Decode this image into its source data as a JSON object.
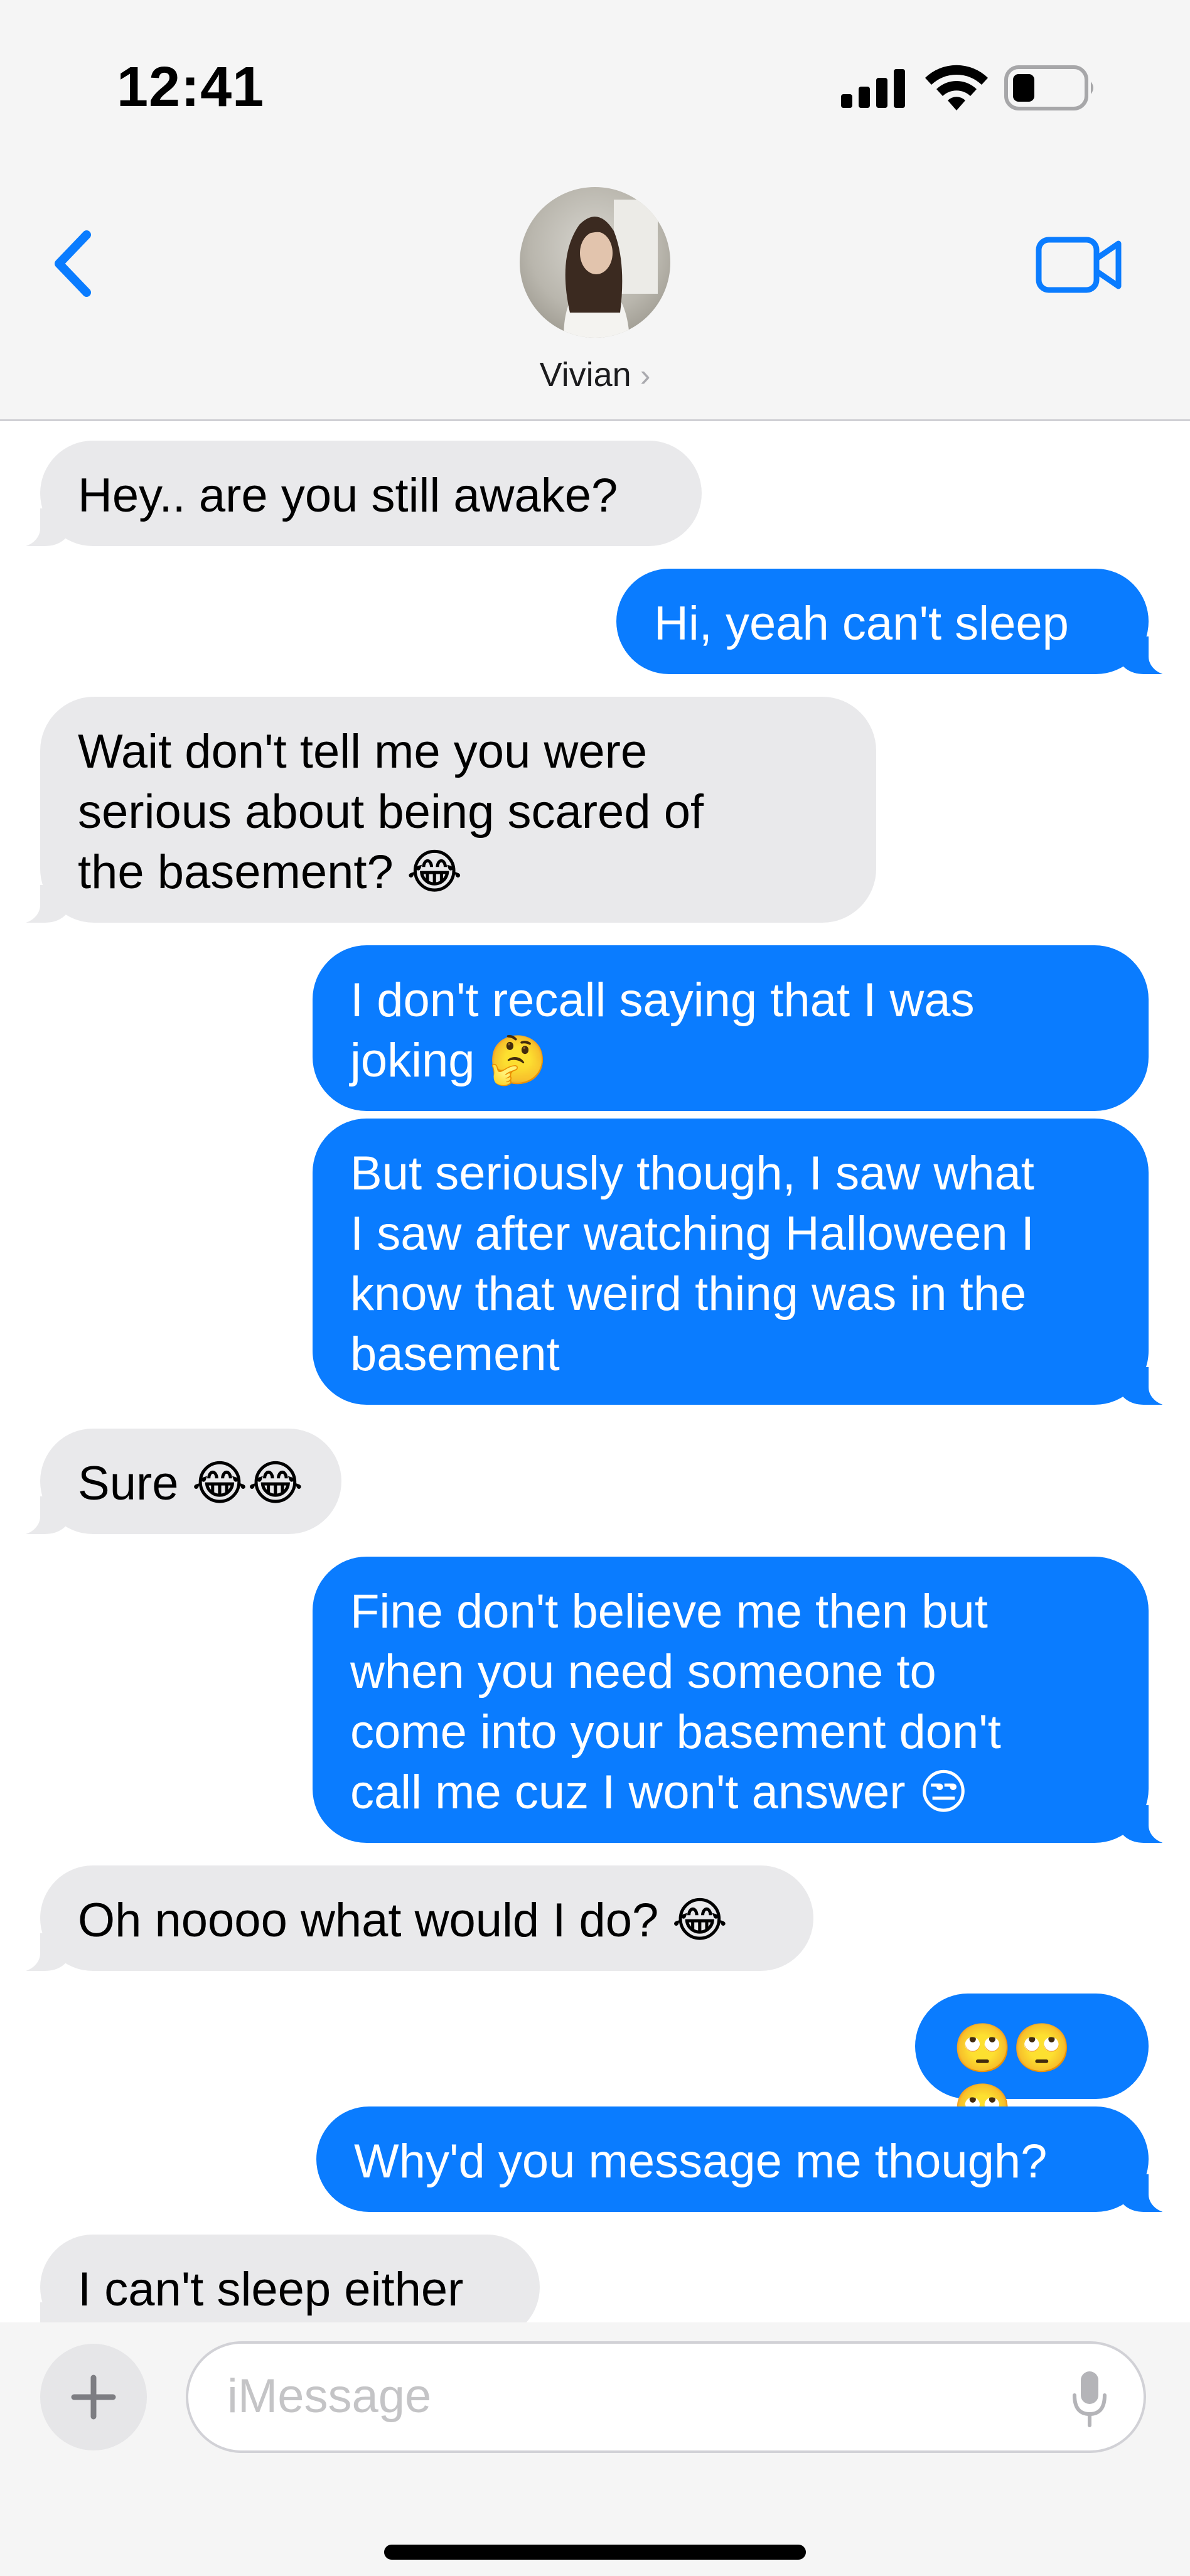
{
  "status_bar": {
    "time": "12:41"
  },
  "header": {
    "contact_name": "Vivian",
    "chevron": "›"
  },
  "messages": [
    {
      "from": "them",
      "text": "Hey.. are you still awake?"
    },
    {
      "from": "me",
      "text": "Hi, yeah can't sleep"
    },
    {
      "from": "them",
      "text": "Wait don't tell me you were\nserious about being scared of\nthe basement? 😂"
    },
    {
      "from": "me",
      "text": "I don't recall saying that I was\njoking 🤔"
    },
    {
      "from": "me",
      "text": "But seriously though, I saw what\nI saw after watching Halloween I\nknow that weird thing was in the\nbasement"
    },
    {
      "from": "them",
      "text": "Sure 😂😂"
    },
    {
      "from": "me",
      "text": "Fine don't believe me then but\nwhen you need someone to\ncome into your basement don't\ncall me cuz I won't answer 😒"
    },
    {
      "from": "them",
      "text": "Oh noooo what would I do? 😂"
    },
    {
      "from": "me",
      "text": "🙄🙄🙄"
    },
    {
      "from": "me",
      "text": "Why'd you message me though?"
    },
    {
      "from": "them",
      "text": "I can't sleep either"
    }
  ],
  "composer": {
    "placeholder": "iMessage",
    "plus_label": "+"
  },
  "colors": {
    "sent": "#0a7cff",
    "received": "#e9e9eb",
    "accent": "#0a7cff"
  },
  "icons": [
    "back-chevron-icon",
    "video-camera-icon",
    "signal-icon",
    "wifi-icon",
    "battery-icon",
    "plus-icon",
    "microphone-icon"
  ]
}
